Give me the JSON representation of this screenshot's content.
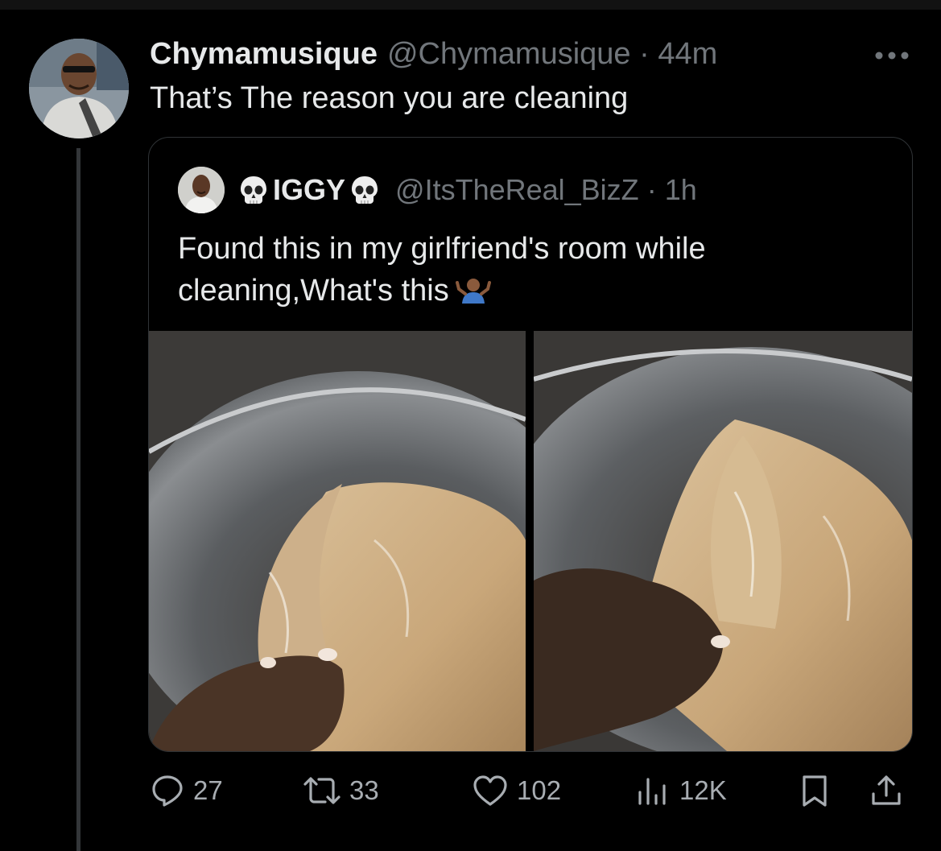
{
  "tweet": {
    "display_name": "Chymamusique",
    "handle": "@Chymamusique",
    "separator": "·",
    "time": "44m",
    "text": "That’s The reason you are cleaning",
    "avatar_icon": "profile-photo"
  },
  "quoted_tweet": {
    "display_name": "IGGY",
    "name_emoji": "skull-emoji",
    "handle": "@ItsTheReal_BizZ",
    "separator": "·",
    "time": "1h",
    "text": "Found this in my girlfriend's room while cleaning,What's this",
    "trailing_emoji": "person-shrugging-emoji",
    "media_count": 2
  },
  "actions": {
    "reply": {
      "icon": "reply-icon",
      "count": "27"
    },
    "retweet": {
      "icon": "retweet-icon",
      "count": "33"
    },
    "like": {
      "icon": "heart-icon",
      "count": "102"
    },
    "views": {
      "icon": "views-icon",
      "count": "12K"
    },
    "bookmark": {
      "icon": "bookmark-icon"
    },
    "share": {
      "icon": "share-icon"
    }
  },
  "colors": {
    "background": "#000000",
    "text_primary": "#e7e9ea",
    "text_secondary": "#71767b",
    "border": "#2f3336",
    "action_gray": "#a8adb2"
  }
}
